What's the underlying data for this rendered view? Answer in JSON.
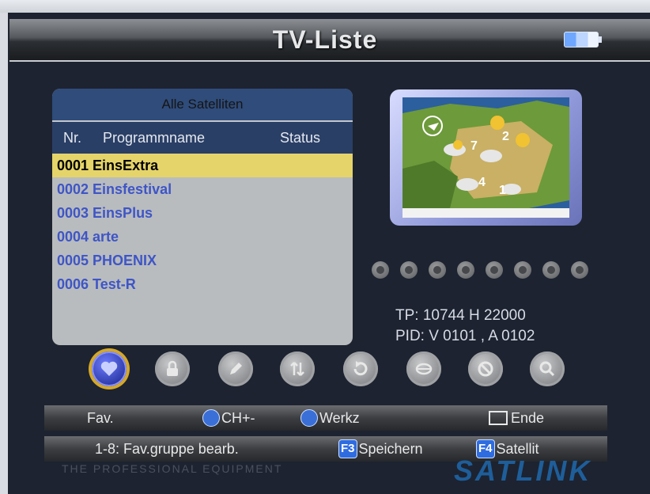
{
  "title": "TV-Liste",
  "panel": {
    "header": "Alle Satelliten",
    "columns": {
      "nr": "Nr.",
      "name": "Programmname",
      "status": "Status"
    },
    "rows": [
      "0001 EinsExtra",
      "0002 Einsfestival",
      "0003 EinsPlus",
      "0004 arte",
      "0005 PHOENIX",
      "0006 Test-R"
    ]
  },
  "info": {
    "tp": "TP: 10744 H 22000",
    "pid": "PID: V 0101 , A 0102"
  },
  "bottom_bar_1": {
    "fav": "Fav.",
    "ch": "CH+-",
    "werkz": "Werkz",
    "ende": "Ende"
  },
  "bottom_bar_2": {
    "fav_edit": "1-8: Fav.gruppe bearb.",
    "f3_key": "F3",
    "f3_label": "Speichern",
    "f4_key": "F4",
    "f4_label": "Satellit"
  },
  "preview": {
    "weather_numbers": [
      "2",
      "7",
      "4",
      "1"
    ]
  },
  "watermark": "THE PROFESSIONAL EQUIPMENT",
  "brand": "SATLINK",
  "colors": {
    "selected_row": "#e5d46a",
    "channel_text": "#3e55c7",
    "header_bg": "#2f4c7a"
  },
  "function_icons": [
    "favorite-icon",
    "lock-icon",
    "edit-icon",
    "move-icon",
    "skip-icon",
    "rename-icon",
    "delete-icon",
    "search-icon"
  ],
  "status_icons": [
    "tv-icon",
    "globe-icon",
    "radio-icon",
    "music-icon",
    "hd-icon",
    "sat-icon",
    "lock-icon",
    "person-icon"
  ]
}
